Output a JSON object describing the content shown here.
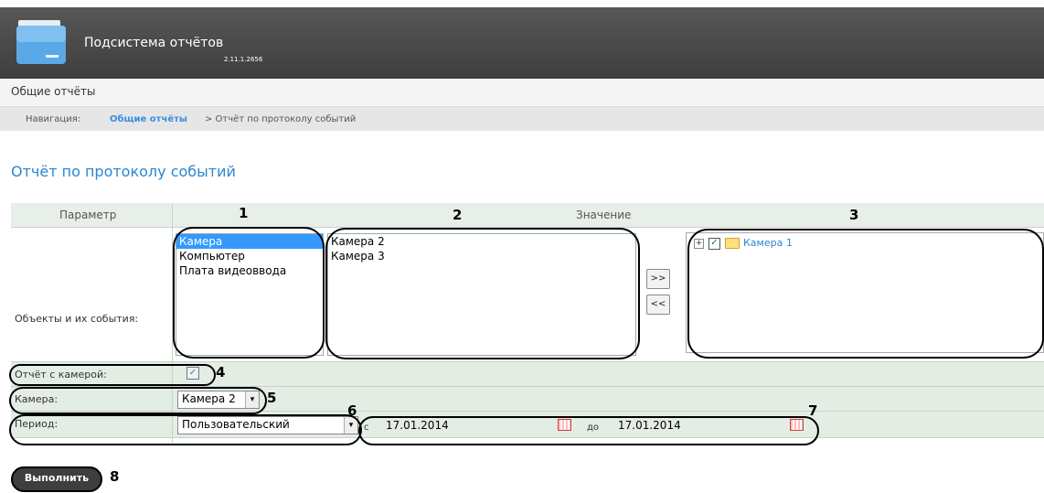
{
  "app": {
    "title": "Подсистема отчётов",
    "version": "2.11.1.2656"
  },
  "section": {
    "title": "Общие отчёты"
  },
  "breadcrumb": {
    "label": "Навигация:",
    "link": "Общие отчёты",
    "current": "> Отчёт по протоколу событий"
  },
  "page": {
    "title": "Отчёт по протоколу событий"
  },
  "table": {
    "col_param": "Параметр",
    "col_value": "Значение",
    "rows": {
      "objects": "Объекты и их события:",
      "report_camera": "Отчёт с камерой:",
      "camera": "Камера:",
      "period": "Период:"
    }
  },
  "object_types": [
    {
      "label": "Камера",
      "selected": true
    },
    {
      "label": "Компьютер",
      "selected": false
    },
    {
      "label": "Плата видеоввода",
      "selected": false
    }
  ],
  "available_objects": [
    "Камера 2",
    "Камера 3"
  ],
  "move_buttons": {
    "add": ">>",
    "remove": "<<"
  },
  "selected_tree": {
    "expand": "+",
    "check": "✓",
    "item": "Камера 1"
  },
  "report_with_camera": {
    "checked": true,
    "mark": "✓"
  },
  "camera_select": {
    "value": "Камера 2",
    "arrow": "▾"
  },
  "period_select": {
    "value": "Пользовательский",
    "arrow": "▾"
  },
  "date_range": {
    "from_label": "с",
    "from": "17.01.2014",
    "to_label": "до",
    "to": "17.01.2014"
  },
  "callouts": [
    "1",
    "2",
    "3",
    "4",
    "5",
    "6",
    "7",
    "8"
  ],
  "run_button": "Выполнить",
  "colors": {
    "header_bg": "#4a4a4a",
    "accent": "#2a86d1",
    "row_bg": "#e4ede4",
    "selection": "#3399ff"
  }
}
